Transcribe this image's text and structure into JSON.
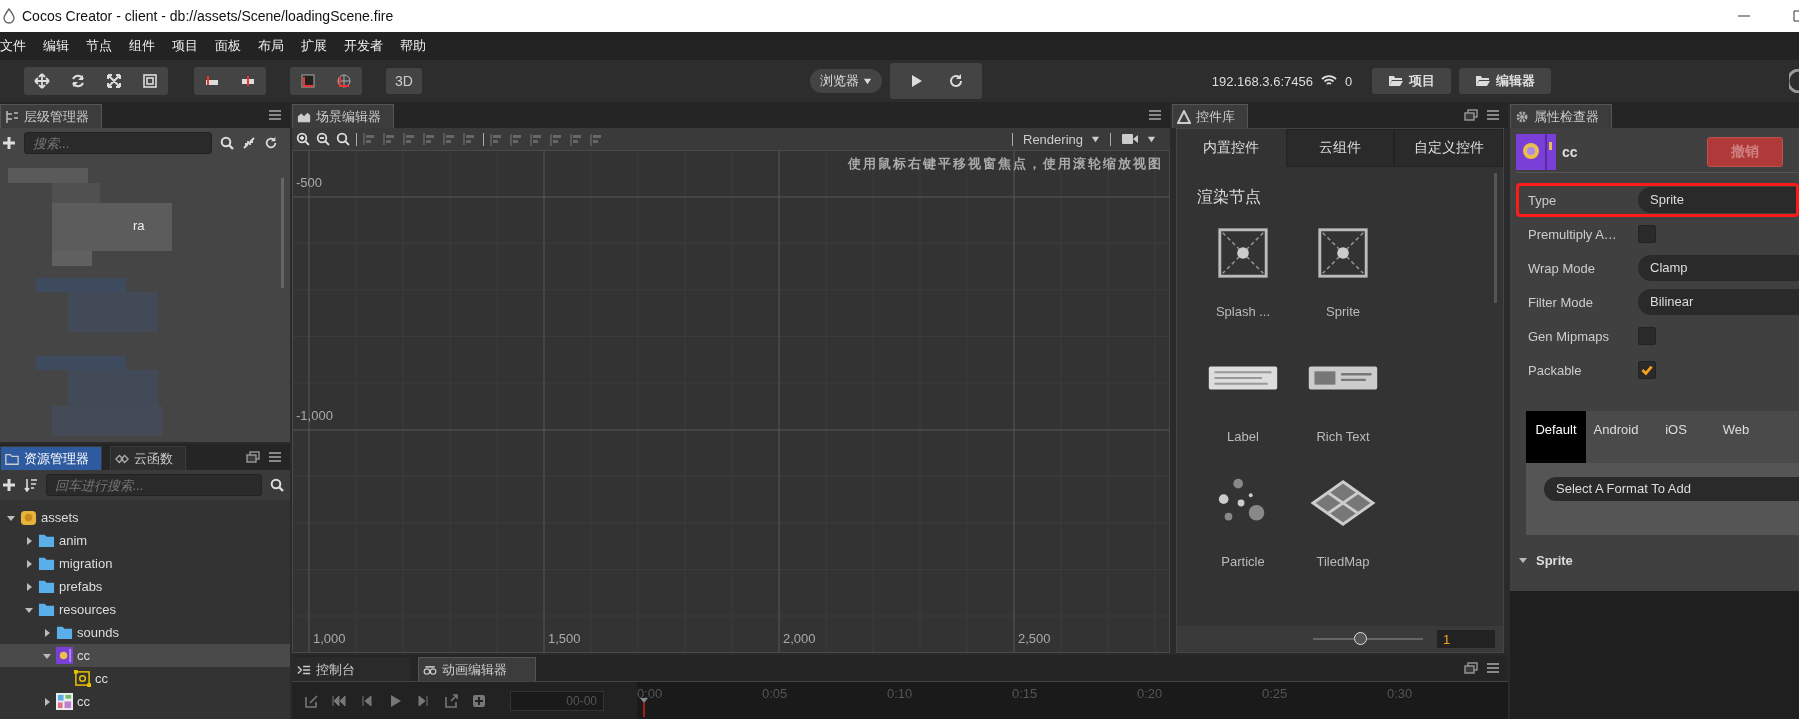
{
  "window": {
    "title": "Cocos Creator - client - db://assets/Scene/loadingScene.fire"
  },
  "menu": [
    "文件",
    "编辑",
    "节点",
    "组件",
    "项目",
    "面板",
    "布局",
    "扩展",
    "开发者",
    "帮助"
  ],
  "toolbar": {
    "mode_button": "3D",
    "platform": "浏览器",
    "server": "192.168.3.6:7456",
    "connections": "0",
    "buttons": [
      "项目",
      "编辑器"
    ]
  },
  "hierarchy": {
    "tab": "层级管理器",
    "search": {
      "placeholder": "搜索..."
    },
    "visible_text": "ra"
  },
  "assets": {
    "tabs": [
      {
        "label": "资源管理器",
        "selected": true
      },
      {
        "label": "云函数",
        "selected": false
      }
    ],
    "search": {
      "placeholder": "回车进行搜索..."
    },
    "tree": [
      {
        "label": "assets",
        "kind": "db",
        "expanded": true,
        "selected": false,
        "children": [
          {
            "label": "anim",
            "kind": "folder",
            "expanded": false,
            "selected": false
          },
          {
            "label": "migration",
            "kind": "folder",
            "expanded": false,
            "selected": false
          },
          {
            "label": "prefabs",
            "kind": "folder",
            "expanded": false,
            "selected": false
          },
          {
            "label": "resources",
            "kind": "folder",
            "expanded": true,
            "selected": false,
            "children": [
              {
                "label": "sounds",
                "kind": "folder",
                "expanded": false,
                "selected": false
              },
              {
                "label": "cc",
                "kind": "texture",
                "expanded": true,
                "selected": true,
                "children": [
                  {
                    "label": "cc",
                    "kind": "sprite-frame",
                    "selected": false
                  }
                ]
              },
              {
                "label": "cc",
                "kind": "atlas",
                "expanded": false,
                "selected": false
              }
            ]
          }
        ]
      }
    ]
  },
  "scene": {
    "tab": "场景编辑器",
    "render_mode": "Rendering",
    "hint": "使用鼠标右键平移视窗焦点，使用滚轮缩放视图",
    "y_labels": [
      "-500",
      "-1,000"
    ],
    "x_labels": [
      "1,000",
      "1,500",
      "2,000",
      "2,500"
    ]
  },
  "library": {
    "tab": "控件库",
    "tabs": [
      {
        "label": "内置控件",
        "selected": true
      },
      {
        "label": "云组件",
        "selected": false
      },
      {
        "label": "自定义控件",
        "selected": false
      }
    ],
    "section": "渲染节点",
    "items": [
      {
        "label": "Splash ...",
        "kind": "sprite"
      },
      {
        "label": "Sprite",
        "kind": "sprite"
      },
      {
        "label": "Label",
        "kind": "label"
      },
      {
        "label": "Rich Text",
        "kind": "richtext"
      },
      {
        "label": "Particle",
        "kind": "particle"
      },
      {
        "label": "TiledMap",
        "kind": "tiledmap"
      }
    ],
    "zoom": {
      "level": 0.44,
      "value": "1"
    }
  },
  "bottom": {
    "tabs": [
      {
        "label": "控制台",
        "kind": "console",
        "selected": false
      },
      {
        "label": "动画编辑器",
        "kind": "animation",
        "selected": true
      }
    ],
    "time": "00-00",
    "ticks": [
      "0:00",
      "0:05",
      "0:10",
      "0:15",
      "0:20",
      "0:25",
      "0:30"
    ]
  },
  "inspector": {
    "tab": "属性检查器",
    "node": "cc",
    "revert_button": "撤销",
    "properties": [
      {
        "label": "Type",
        "kind": "dropdown",
        "value": "Sprite",
        "highlighted": true
      },
      {
        "label": "Premultiply A…",
        "kind": "checkbox",
        "checked": false,
        "highlighted": false
      },
      {
        "label": "Wrap Mode",
        "kind": "dropdown",
        "value": "Clamp",
        "highlighted": false
      },
      {
        "label": "Filter Mode",
        "kind": "dropdown",
        "value": "Bilinear",
        "highlighted": false
      },
      {
        "label": "Gen Mipmaps",
        "kind": "checkbox",
        "checked": false,
        "highlighted": false
      },
      {
        "label": "Packable",
        "kind": "checkbox",
        "checked": true,
        "highlighted": false
      }
    ],
    "platforms": [
      {
        "label": "Default",
        "selected": true
      },
      {
        "label": "Android",
        "selected": false
      },
      {
        "label": "iOS",
        "selected": false
      },
      {
        "label": "Web",
        "selected": false
      }
    ],
    "format_select": "Select A Format To Add",
    "section": {
      "label": "Sprite",
      "expanded": true
    }
  }
}
